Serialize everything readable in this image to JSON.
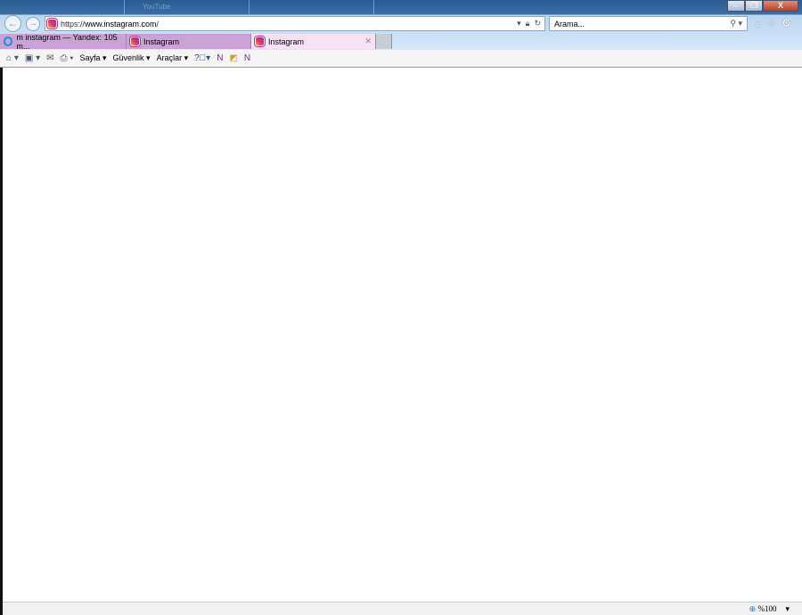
{
  "background_tabs": [
    "YouTube"
  ],
  "window_controls": {
    "minimize": "–",
    "restore": "❐",
    "close": "X"
  },
  "address_bar": {
    "url_prefix": "https://",
    "url_domain": "www.instagram.com",
    "url_suffix": "/"
  },
  "search": {
    "placeholder": "Arama..."
  },
  "tabs": [
    {
      "label": "m instagram — Yandex: 105 m..."
    },
    {
      "label": "Instagram"
    },
    {
      "label": "Instagram",
      "active": true
    }
  ],
  "command_bar": {
    "page": "Sayfa",
    "safety": "Güvenlik",
    "tools": "Araçlar"
  },
  "status_bar": {
    "zoom": "%100"
  }
}
